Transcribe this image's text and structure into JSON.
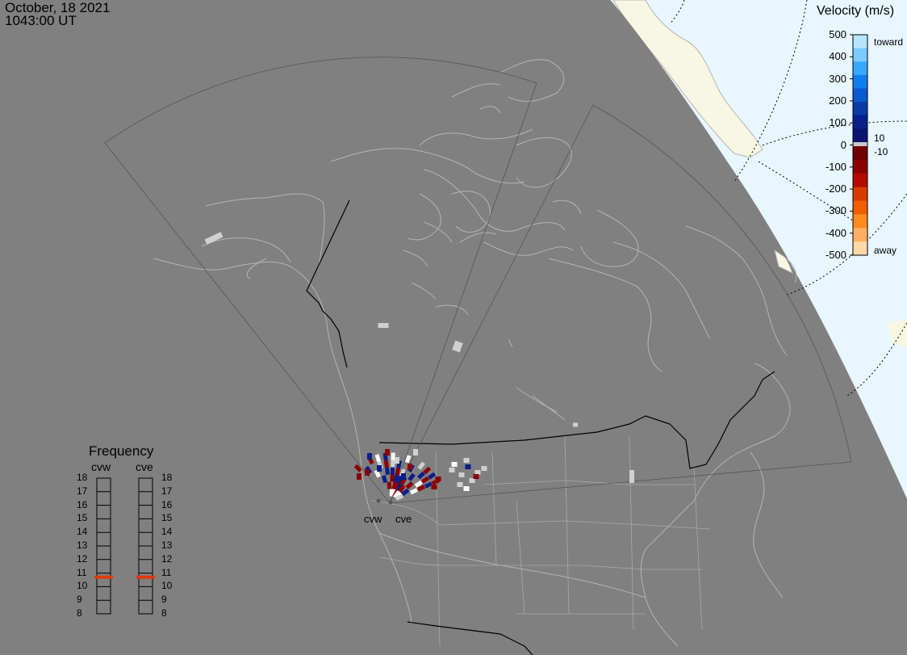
{
  "header": {
    "date": "October, 18 2021",
    "time": "1043:00 UT"
  },
  "legend": {
    "title": "Velocity (m/s)",
    "ticks": [
      "500",
      "400",
      "300",
      "200",
      "100",
      "0",
      "-100",
      "-200",
      "-300",
      "-400",
      "-500"
    ],
    "toward_label": "toward",
    "away_label": "away",
    "ground_scatter_labels": [
      "10",
      "-10"
    ],
    "colors": {
      "toward_light": "#b8e4ff",
      "toward_dark": "#0a1f8a",
      "ground_scatter": "#c8c8c8",
      "away_dark": "#7a0000",
      "away_mid": "#ff7a00",
      "away_light": "#ffd8a8"
    }
  },
  "frequency": {
    "title": "Frequency",
    "radars": [
      {
        "name": "cvw",
        "current_mhz": 10.7
      },
      {
        "name": "cve",
        "current_mhz": 10.7
      }
    ],
    "scale": [
      "18",
      "17",
      "16",
      "15",
      "14",
      "13",
      "12",
      "11",
      "10",
      "9",
      "8"
    ],
    "marker_color": "#e03a0a"
  },
  "stations": [
    {
      "code": "cvw"
    },
    {
      "code": "cve"
    }
  ],
  "map_colors": {
    "night_side": "#808080",
    "day_ocean": "#e8f6ff",
    "day_land": "#f8f7e3",
    "coastline": "#b4b4b4",
    "fov_outline": "#555555"
  }
}
